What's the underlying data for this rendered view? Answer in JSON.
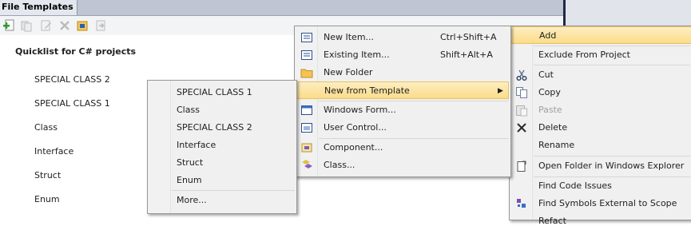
{
  "panel": {
    "tab_title": "File Templates",
    "heading": "Quicklist for C# projects",
    "quicklist": [
      "SPECIAL CLASS 2",
      "SPECIAL CLASS 1",
      "Class",
      "Interface",
      "Struct",
      "Enum"
    ]
  },
  "template_submenu": {
    "items": [
      "SPECIAL CLASS 1",
      "Class",
      "SPECIAL CLASS 2",
      "Interface",
      "Struct",
      "Enum"
    ],
    "more": "More..."
  },
  "add_submenu": {
    "new_item": "New Item...",
    "new_item_shortcut": "Ctrl+Shift+A",
    "existing_item": "Existing Item...",
    "existing_item_shortcut": "Shift+Alt+A",
    "new_folder": "New Folder",
    "new_from_template": "New from Template",
    "windows_form": "Windows Form...",
    "user_control": "User Control...",
    "component": "Component...",
    "class": "Class..."
  },
  "context_menu": {
    "add": "Add",
    "exclude": "Exclude From Project",
    "cut": "Cut",
    "copy": "Copy",
    "paste": "Paste",
    "delete": "Delete",
    "rename": "Rename",
    "open_folder": "Open Folder in Windows Explorer",
    "find_code_issues": "Find Code Issues",
    "find_symbols": "Find Symbols External to Scope",
    "refactor_partial": "Refact"
  },
  "colors": {
    "highlight": "#fbdc8a",
    "menu_bg": "#f0f0f0",
    "tab_strip": "#c0c6d1"
  }
}
